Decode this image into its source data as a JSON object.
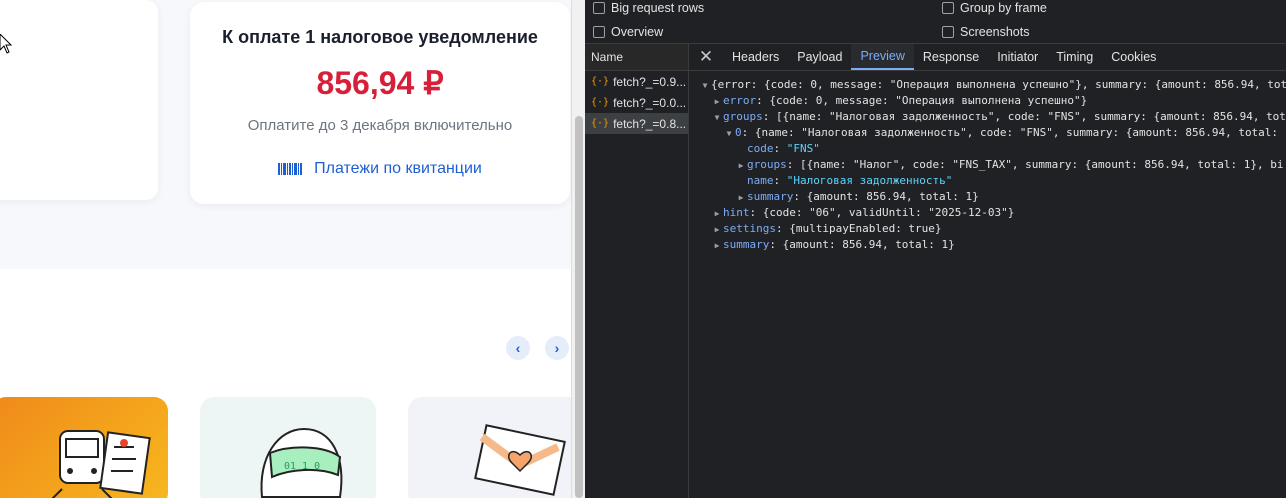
{
  "web": {
    "card": {
      "title": "К оплате 1 налоговое уведомление",
      "amount": "856,94 ₽",
      "due": "Оплатите до 3 декабря включительно",
      "link": "Платежи по квитанции"
    },
    "nav_prev": "‹",
    "nav_next": "›",
    "colors": {
      "accent": "#1f5fd6",
      "amount": "#d6203a"
    }
  },
  "devtools": {
    "options": {
      "big_rows": "Big request rows",
      "group_by_frame": "Group by frame",
      "overview": "Overview",
      "screenshots": "Screenshots"
    },
    "name_header": "Name",
    "requests": [
      {
        "name": "fetch?_=0.9...",
        "selected": false
      },
      {
        "name": "fetch?_=0.0...",
        "selected": false
      },
      {
        "name": "fetch?_=0.8...",
        "selected": true
      }
    ],
    "tabs": [
      "Headers",
      "Payload",
      "Preview",
      "Response",
      "Initiator",
      "Timing",
      "Cookies"
    ],
    "active_tab": "Preview",
    "preview": {
      "root": "{error: {code: 0, message: \"Операция выполнена успешно\"}, summary: {amount: 856.94, tot",
      "error_key": "error",
      "error_val": ": {code: 0, message: \"Операция выполнена успешно\"}",
      "groups_key": "groups",
      "groups_val": ": [{name: \"Налоговая задолженность\", code: \"FNS\", summary: {amount: 856.94, tot",
      "g0_key": "0",
      "g0_val": ": {name: \"Налоговая задолженность\", code: \"FNS\", summary: {amount: 856.94, total: ",
      "code_key": "code",
      "code_val": "\"FNS\"",
      "subgroups_key": "groups",
      "subgroups_val": ": [{name: \"Налог\", code: \"FNS_TAX\", summary: {amount: 856.94, total: 1}, bi",
      "name_key": "name",
      "name_val": "\"Налоговая задолженность\"",
      "sum_key": "summary",
      "sum_val": ": {amount: 856.94, total: 1}",
      "hint_key": "hint",
      "hint_val": ": {code: \"06\", validUntil: \"2025-12-03\"}",
      "settings_key": "settings",
      "settings_val": ": {multipayEnabled: true}",
      "summary_key": "summary",
      "summary_val": ": {amount: 856.94, total: 1}"
    }
  }
}
